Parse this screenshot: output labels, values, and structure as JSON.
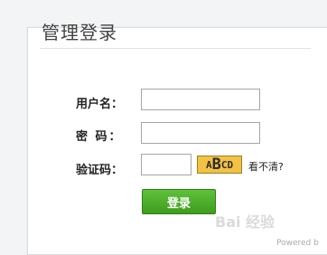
{
  "page": {
    "title": "管理登录"
  },
  "form": {
    "username_label": "用户名：",
    "password_label": "密 码：",
    "captcha_label": "验证码：",
    "captcha_text": [
      "A",
      "B",
      "C",
      "D"
    ],
    "refresh_label": "看不清?",
    "submit_label": "登录"
  },
  "footer": {
    "watermark": "Bai 经验",
    "powered": "Powered b"
  },
  "colors": {
    "button_green": "#4aa329",
    "captcha_yellow": "#f2c243"
  }
}
